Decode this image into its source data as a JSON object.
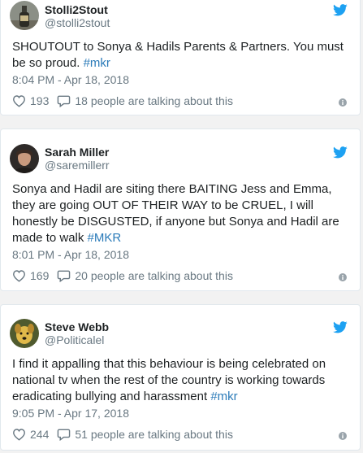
{
  "colors": {
    "page_background": "#f2f2f2",
    "card_background": "#ffffff",
    "text": "#1c2022",
    "muted": "#697882",
    "link": "#2b7bb9",
    "twitter_blue": "#1da1f2"
  },
  "tweets": [
    {
      "name": "Stolli2Stout",
      "handle": "@stolli2stout",
      "avatar_icon": "stout-bottle-photo",
      "text_plain": "SHOUTOUT to Sonya & Hadils Parents & Partners. You must be so proud. ",
      "hashtag": "#mkr",
      "timestamp": "8:04 PM - Apr 18, 2018",
      "likes": "193",
      "talking": "18 people are talking about this"
    },
    {
      "name": "Sarah Miller",
      "handle": "@saremillerr",
      "avatar_icon": "woman-portrait-photo",
      "text_plain": "Sonya and Hadil are siting there BAITING Jess and Emma, they are going OUT OF THEIR WAY to be CRUEL, I will honestly be DISGUSTED, if anyone but Sonya and Hadil are made to walk ",
      "hashtag": "#MKR",
      "timestamp": "8:01 PM - Apr 18, 2018",
      "likes": "169",
      "talking": "20 people are talking about this"
    },
    {
      "name": "Steve Webb",
      "handle": "@Politicalel",
      "avatar_icon": "dog-photo",
      "text_plain": "I find it appalling that this behaviour is being celebrated on national tv when the rest of the country is working towards eradicating bullying and harassment ",
      "hashtag": "#mkr",
      "timestamp": "9:05 PM - Apr 17, 2018",
      "likes": "244",
      "talking": "51 people are talking about this"
    }
  ]
}
